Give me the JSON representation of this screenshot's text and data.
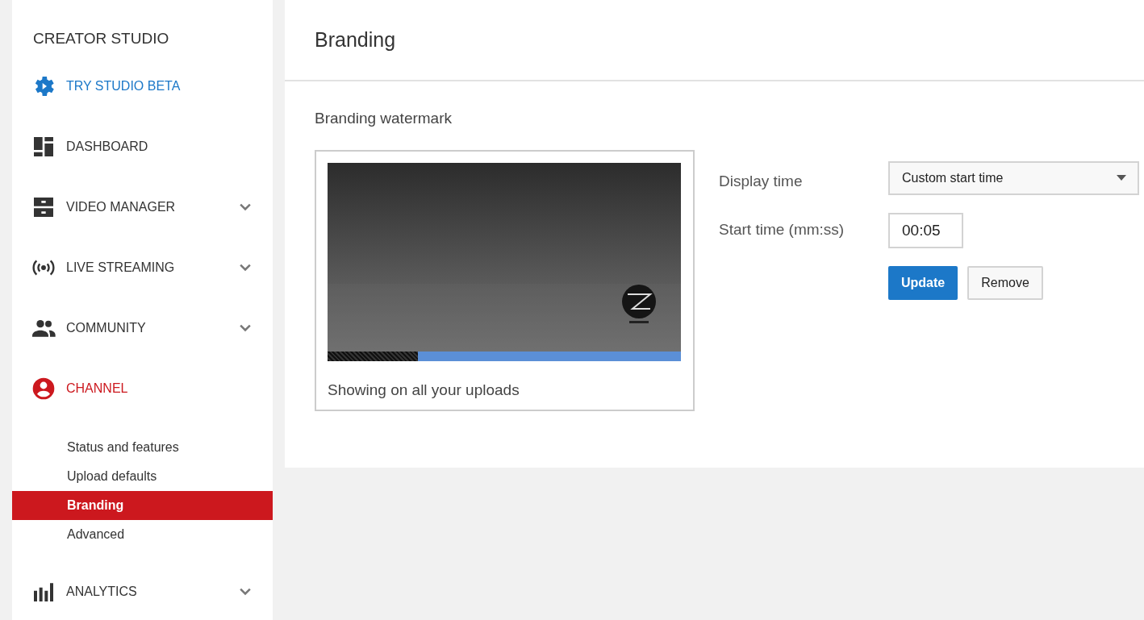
{
  "sidebar": {
    "title": "CREATOR STUDIO",
    "items": [
      {
        "label": "TRY STUDIO BETA",
        "kind": "promo",
        "selected": false,
        "expandable": false
      },
      {
        "label": "DASHBOARD",
        "kind": "section",
        "selected": false,
        "expandable": false
      },
      {
        "label": "VIDEO MANAGER",
        "kind": "section",
        "selected": false,
        "expandable": true
      },
      {
        "label": "LIVE STREAMING",
        "kind": "section",
        "selected": false,
        "expandable": true
      },
      {
        "label": "COMMUNITY",
        "kind": "section",
        "selected": false,
        "expandable": true
      },
      {
        "label": "CHANNEL",
        "kind": "section",
        "selected": true,
        "expandable": false,
        "children": [
          {
            "label": "Status and features",
            "selected": false
          },
          {
            "label": "Upload defaults",
            "selected": false
          },
          {
            "label": "Branding",
            "selected": true
          },
          {
            "label": "Advanced",
            "selected": false
          }
        ]
      },
      {
        "label": "ANALYTICS",
        "kind": "section",
        "selected": false,
        "expandable": true
      }
    ]
  },
  "page": {
    "title": "Branding",
    "section_title": "Branding watermark",
    "preview": {
      "kind": "picture",
      "timeline": {
        "level": 0.256
      },
      "caption": "Showing on all your uploads"
    },
    "display_time": {
      "label": "Display time",
      "value": "Custom start time"
    },
    "start_time": {
      "label": "Start time (mm:ss)",
      "value": "00:05"
    },
    "buttons": [
      {
        "label": "Update",
        "primary": true
      },
      {
        "label": "Remove",
        "primary": false
      }
    ]
  }
}
